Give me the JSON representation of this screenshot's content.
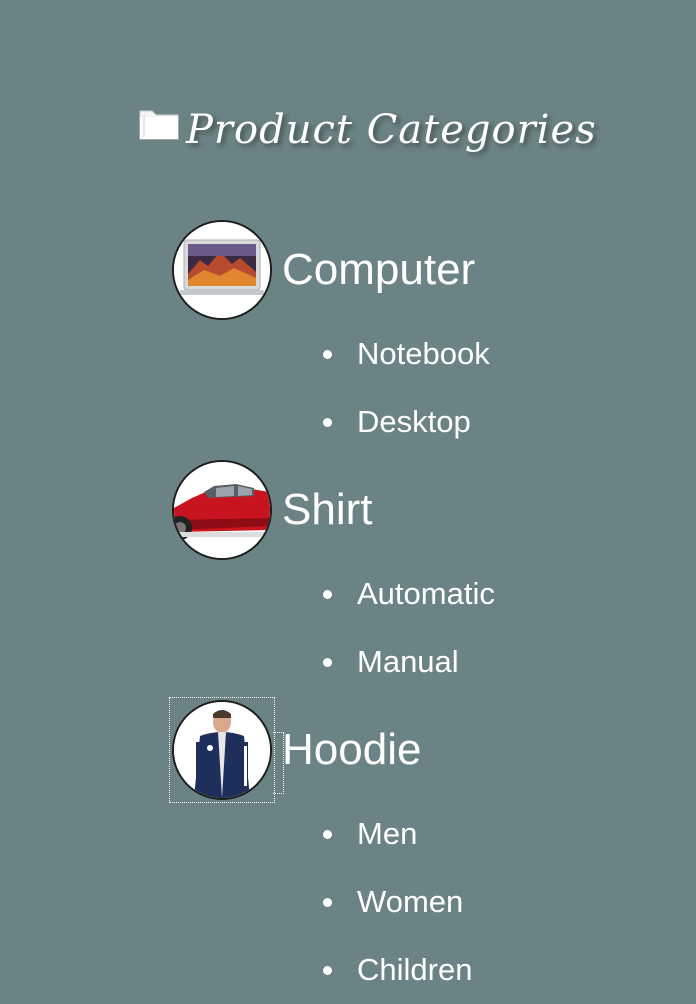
{
  "header": {
    "icon": "folder-icon",
    "title": "Product Categories"
  },
  "categories": [
    {
      "name": "Computer",
      "image": "laptop-image",
      "subcategories": [
        "Notebook",
        "Desktop"
      ]
    },
    {
      "name": "Shirt",
      "image": "red-car-image",
      "subcategories": [
        "Automatic",
        "Manual"
      ]
    },
    {
      "name": "Hoodie",
      "image": "man-in-jacket-image",
      "subcategories": [
        "Men",
        "Women",
        "Children"
      ]
    }
  ],
  "colors": {
    "background": "#6b8384",
    "text": "#ffffff"
  }
}
